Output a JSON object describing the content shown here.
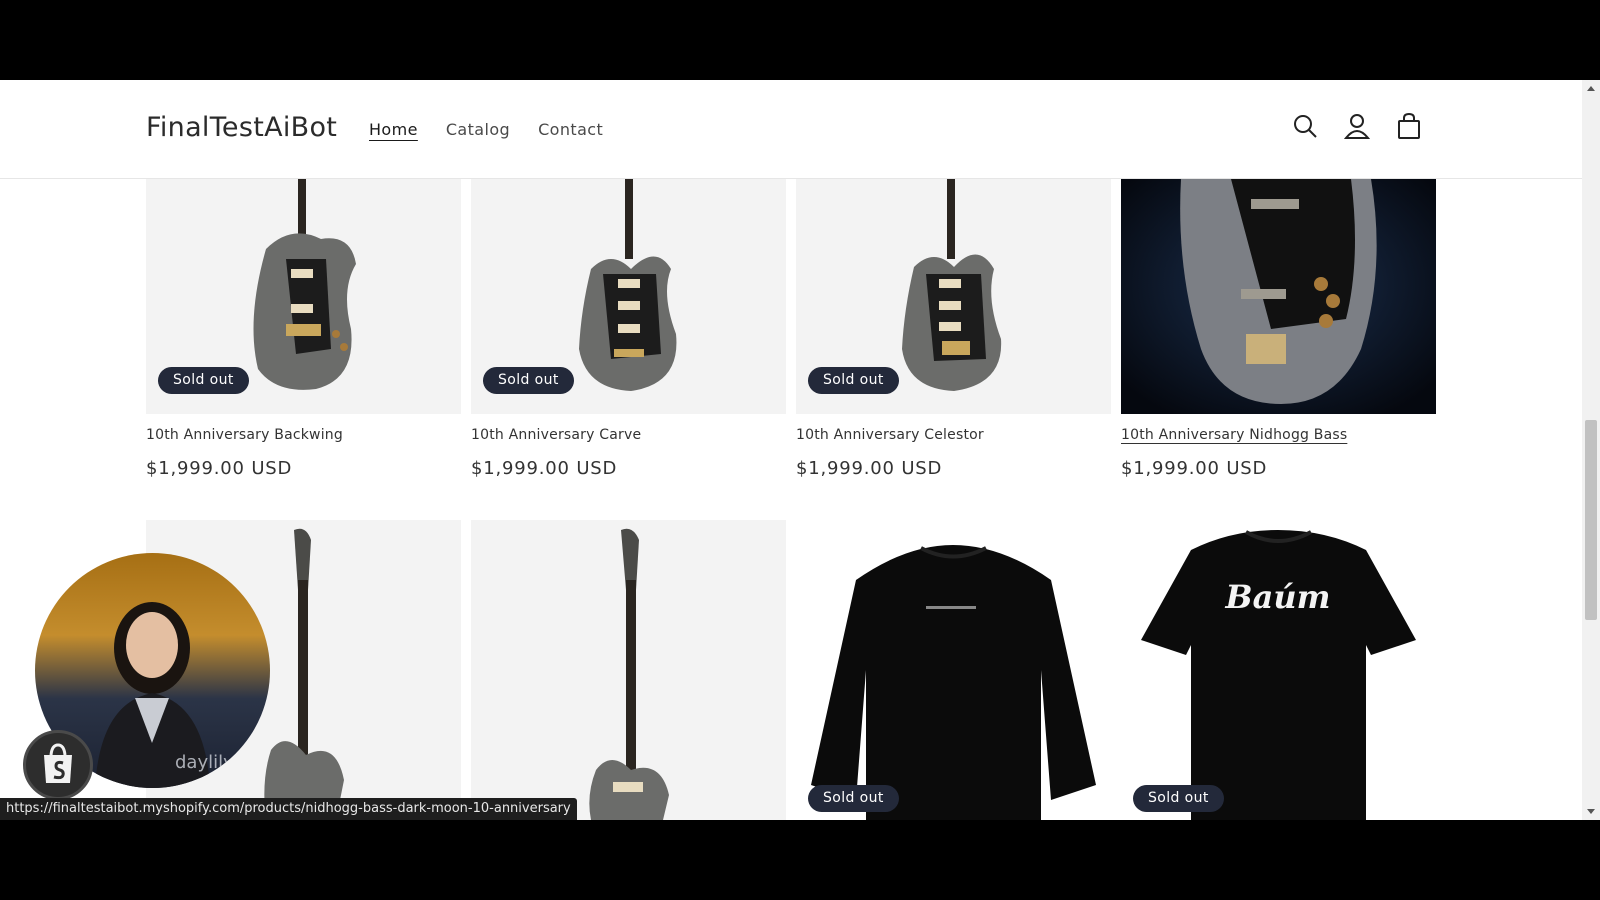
{
  "store": {
    "name": "FinalTestAiBot",
    "nav": [
      "Home",
      "Catalog",
      "Contact"
    ]
  },
  "header_icons": [
    "search-icon",
    "account-icon",
    "cart-icon"
  ],
  "products": [
    {
      "title": "10th Anniversary Backwing",
      "price": "$1,999.00 USD",
      "badge": "Sold out"
    },
    {
      "title": "10th Anniversary Carve",
      "price": "$1,999.00 USD",
      "badge": "Sold out"
    },
    {
      "title": "10th Anniversary Celestor",
      "price": "$1,999.00 USD",
      "badge": "Sold out"
    },
    {
      "title": "10th Anniversary Nidhogg Bass",
      "price": "$1,999.00 USD",
      "badge": ""
    },
    {
      "title": "",
      "price": "",
      "badge": ""
    },
    {
      "title": "",
      "price": "",
      "badge": ""
    },
    {
      "title": "",
      "price": "",
      "badge": "Sold out"
    },
    {
      "title": "",
      "price": "",
      "badge": "Sold out"
    }
  ],
  "tshirt_print": "Baúm",
  "video": {
    "watermark": "daylily"
  },
  "status_url": "https://finaltestaibot.myshopify.com/products/nidhogg-bass-dark-moon-10-anniversary",
  "colors": {
    "badge_bg": "#23293a",
    "page_bg": "#ffffff",
    "media_bg": "#f3f3f3"
  }
}
